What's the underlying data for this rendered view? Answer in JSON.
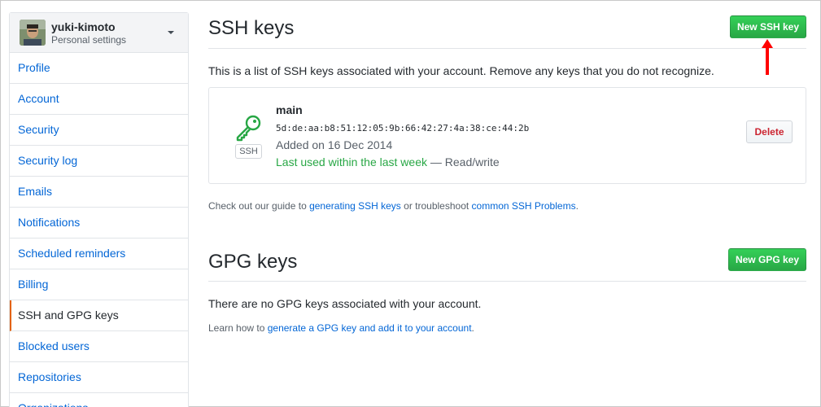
{
  "sidebar": {
    "username": "yuki-kimoto",
    "subtitle": "Personal settings",
    "items": [
      {
        "label": "Profile"
      },
      {
        "label": "Account"
      },
      {
        "label": "Security"
      },
      {
        "label": "Security log"
      },
      {
        "label": "Emails"
      },
      {
        "label": "Notifications"
      },
      {
        "label": "Scheduled reminders"
      },
      {
        "label": "Billing"
      },
      {
        "label": "SSH and GPG keys",
        "selected": true
      },
      {
        "label": "Blocked users"
      },
      {
        "label": "Repositories"
      },
      {
        "label": "Organizations"
      }
    ]
  },
  "ssh": {
    "title": "SSH keys",
    "new_button": "New SSH key",
    "description": "This is a list of SSH keys associated with your account. Remove any keys that you do not recognize.",
    "key": {
      "badge": "SSH",
      "name": "main",
      "fingerprint": "5d:de:aa:b8:51:12:05:9b:66:42:27:4a:38:ce:44:2b",
      "added": "Added on 16 Dec 2014",
      "last_used": "Last used within the last week",
      "access": " — Read/write",
      "delete_button": "Delete"
    },
    "guide_prefix": "Check out our guide to ",
    "guide_link": "generating SSH keys",
    "guide_middle": " or troubleshoot ",
    "problems_link": "common SSH Problems",
    "guide_suffix": "."
  },
  "gpg": {
    "title": "GPG keys",
    "new_button": "New GPG key",
    "empty": "There are no GPG keys associated with your account.",
    "learn_prefix": "Learn how to ",
    "learn_link": "generate a GPG key and add it to your account",
    "learn_suffix": "."
  },
  "colors": {
    "accent_link": "#0366d6",
    "primary_button": "#28a745",
    "danger": "#cb2431",
    "selected_marker": "#e36209",
    "annotation_arrow": "#ff0000"
  },
  "icons": [
    "key-icon",
    "chevron-down-icon",
    "red-arrow-annotation"
  ]
}
